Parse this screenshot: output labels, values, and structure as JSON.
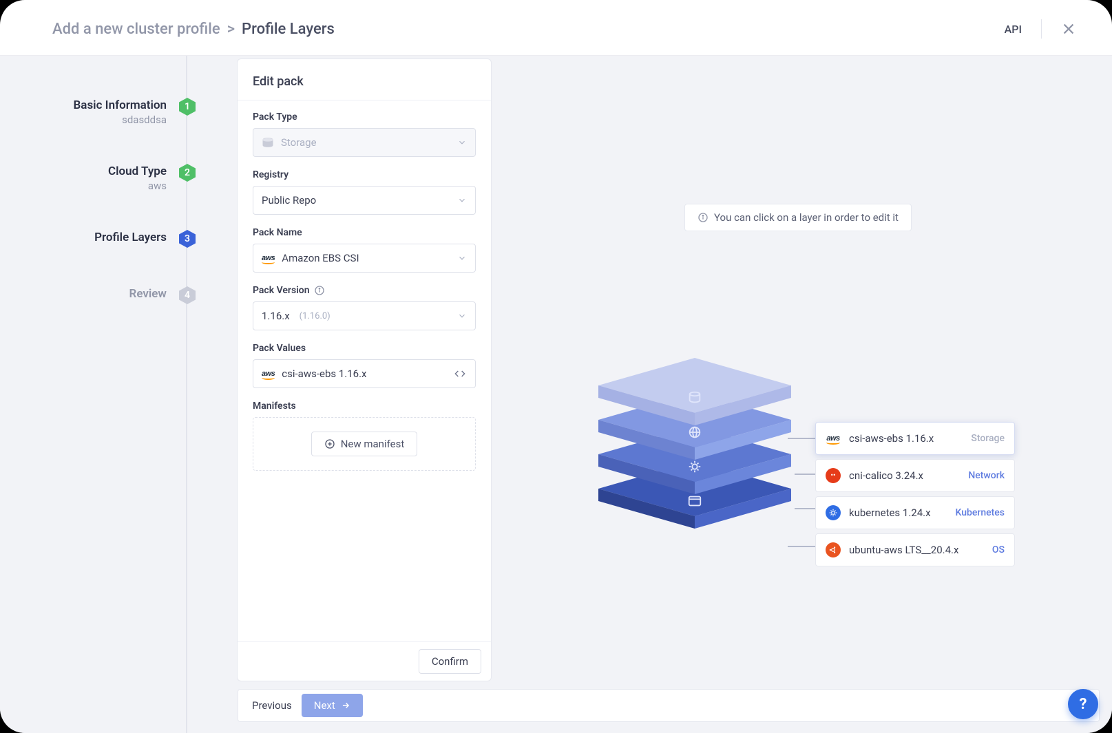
{
  "header": {
    "breadcrumb_parent": "Add a new cluster profile",
    "breadcrumb_current": "Profile Layers",
    "api_label": "API"
  },
  "steps": [
    {
      "num": "1",
      "title": "Basic Information",
      "sub": "sdasddsa",
      "state": "green"
    },
    {
      "num": "2",
      "title": "Cloud Type",
      "sub": "aws",
      "state": "green"
    },
    {
      "num": "3",
      "title": "Profile Layers",
      "sub": "",
      "state": "blue"
    },
    {
      "num": "4",
      "title": "Review",
      "sub": "",
      "state": "gray"
    }
  ],
  "panel": {
    "title": "Edit pack",
    "pack_type_label": "Pack Type",
    "pack_type_value": "Storage",
    "registry_label": "Registry",
    "registry_value": "Public Repo",
    "pack_name_label": "Pack Name",
    "pack_name_value": "Amazon EBS CSI",
    "pack_version_label": "Pack Version",
    "pack_version_value": "1.16.x",
    "pack_version_sub": "(1.16.0)",
    "pack_values_label": "Pack Values",
    "pack_values_value": "csi-aws-ebs 1.16.x",
    "manifests_label": "Manifests",
    "new_manifest_label": "New manifest",
    "confirm_label": "Confirm"
  },
  "canvas": {
    "hint": "You can click on a layer in order to edit it",
    "layers": [
      {
        "name": "csi-aws-ebs 1.16.x",
        "tag": "Storage",
        "tag_class": "storage",
        "icon": "aws",
        "selected": true
      },
      {
        "name": "cni-calico 3.24.x",
        "tag": "Network",
        "tag_class": "network",
        "icon": "calico",
        "selected": false
      },
      {
        "name": "kubernetes 1.24.x",
        "tag": "Kubernetes",
        "tag_class": "k8s",
        "icon": "k8s",
        "selected": false
      },
      {
        "name": "ubuntu-aws LTS__20.4.x",
        "tag": "OS",
        "tag_class": "os",
        "icon": "ubuntu",
        "selected": false
      }
    ]
  },
  "footer": {
    "previous": "Previous",
    "next": "Next"
  },
  "colors": {
    "accent_blue": "#2f6de4",
    "step_green": "#4fbf67",
    "stack_top": "#aeb9e8",
    "stack_2": "#8ea5e9",
    "stack_3": "#6b86db",
    "stack_4": "#4a66c7"
  }
}
